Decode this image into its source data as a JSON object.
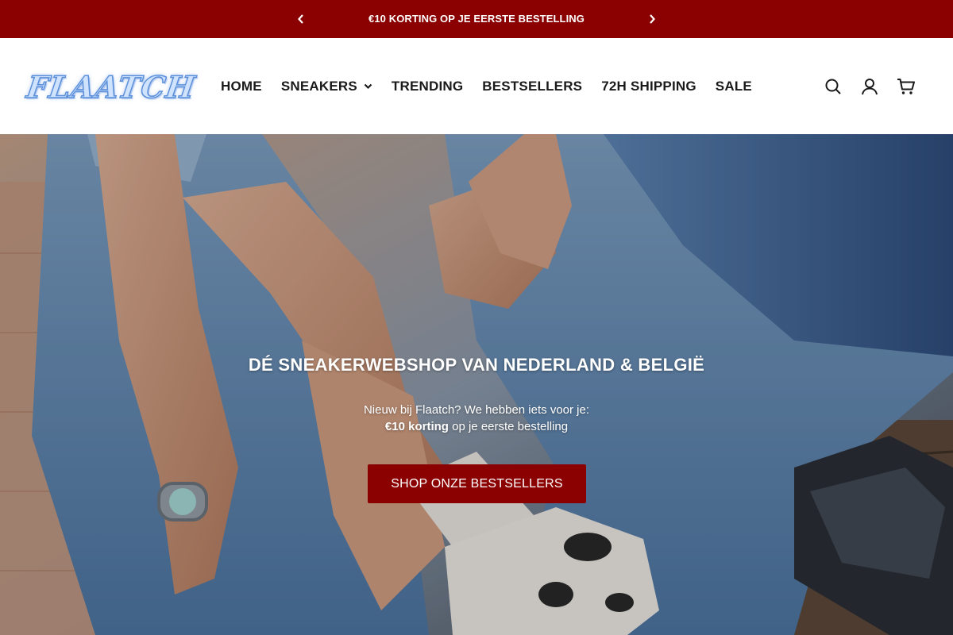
{
  "announcement": {
    "text": "€10 KORTING OP JE EERSTE BESTELLING",
    "prev_icon": "chevron-left-icon",
    "next_icon": "chevron-right-icon",
    "background": "#8b0000"
  },
  "header": {
    "logo_text": "FLAATCH",
    "nav": [
      {
        "label": "HOME"
      },
      {
        "label": "SNEAKERS",
        "icon": "chevron-down-icon"
      },
      {
        "label": "TRENDING"
      },
      {
        "label": "BESTSELLERS"
      },
      {
        "label": "72H SHIPPING"
      },
      {
        "label": "SALE"
      }
    ],
    "icons": [
      "search-icon",
      "account-icon",
      "cart-icon"
    ]
  },
  "hero": {
    "title": "DÉ SNEAKERWEBSHOP VAN NEDERLAND & BELGIË",
    "subtitle_line1": "Nieuw bij Flaatch? We hebben iets voor je:",
    "subtitle_bold": "€10 korting",
    "subtitle_rest": " op je eerste bestelling",
    "button_label": "SHOP ONZE BESTSELLERS",
    "accent": "#8b0000"
  }
}
